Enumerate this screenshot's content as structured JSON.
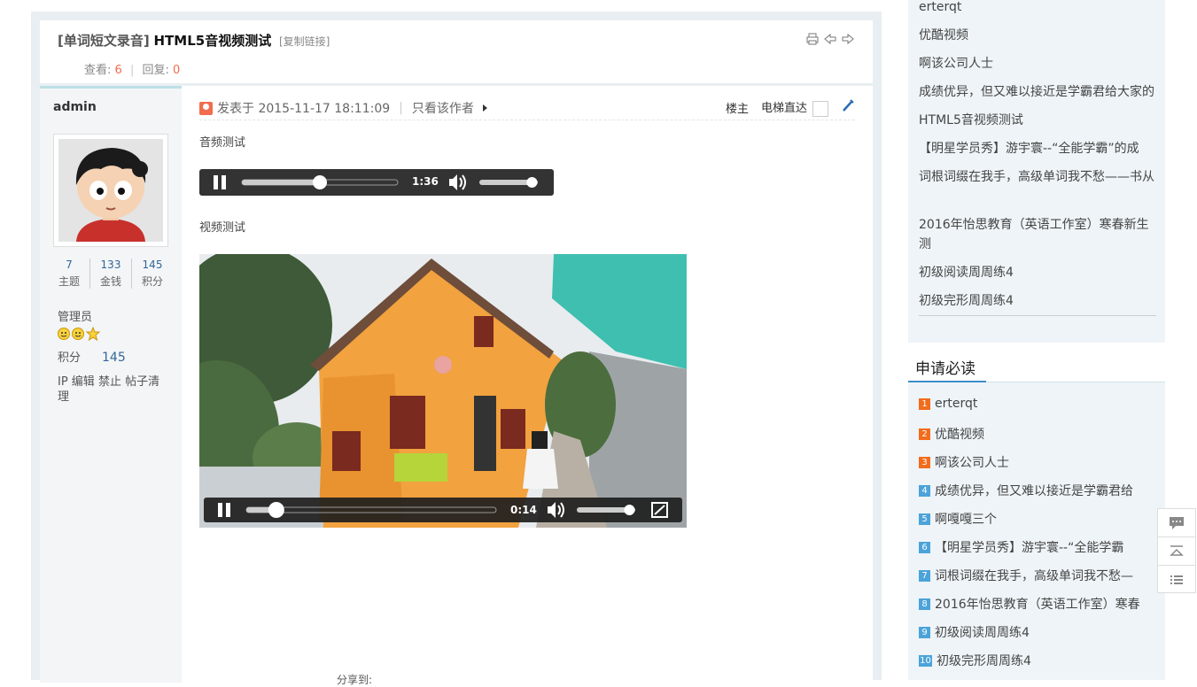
{
  "thread": {
    "category": "[单词短文录音]",
    "title": "HTML5音视频测试",
    "copy_link": "[复制链接]",
    "views_label": "查看:",
    "views": "6",
    "replies_label": "回复:",
    "replies": "0"
  },
  "author": {
    "name": "admin",
    "topics": "7",
    "topics_label": "主题",
    "money": "133",
    "money_label": "金钱",
    "points": "145",
    "points_label": "积分",
    "group": "管理员",
    "score_label": "积分",
    "score_value": "145",
    "admin_links": "IP 编辑 禁止 帖子清理"
  },
  "post": {
    "posted_label": "发表于 2015-11-17 18:11:09",
    "only_author": "只看该作者",
    "floor": "楼主",
    "elevator": "电梯直达",
    "audio_label": "音频测试",
    "audio_time": "1:36",
    "audio_progress": 0.5,
    "audio_volume": 0.9,
    "video_label": "视频测试",
    "video_time": "0:14",
    "video_progress": 0.12,
    "video_volume": 0.9,
    "share_label": "分享到:"
  },
  "sidebar_links": [
    "erterqt",
    "优酷视频",
    "啊该公司人士",
    "成绩优异，但又难以接近是学霸君给大家的",
    "HTML5音视频测试",
    "【明星学员秀】游宇寰--“全能学霸”的成",
    "词根词缀在我手，高级单词我不愁——书从",
    "2016年怡思教育（英语工作室）寒春新生测",
    "初级阅读周周练4",
    "初级完形周周练4"
  ],
  "ranking": {
    "title": "申请必读",
    "items": [
      {
        "num": "1",
        "text": "erterqt"
      },
      {
        "num": "2",
        "text": "优酷视频"
      },
      {
        "num": "3",
        "text": "啊该公司人士"
      },
      {
        "num": "4",
        "text": "成绩优异，但又难以接近是学霸君给"
      },
      {
        "num": "5",
        "text": "啊嘎嘎三个"
      },
      {
        "num": "6",
        "text": "【明星学员秀】游宇寰--“全能学霸"
      },
      {
        "num": "7",
        "text": "词根词缀在我手，高级单词我不愁—"
      },
      {
        "num": "8",
        "text": "2016年怡思教育（英语工作室）寒春"
      },
      {
        "num": "9",
        "text": "初级阅读周周练4"
      },
      {
        "num": "10",
        "text": "初级完形周周练4"
      }
    ]
  },
  "colors": {
    "accent": "#f26c4f",
    "link_blue": "#336699",
    "rank_top": "#f26c1b",
    "rank_rest": "#4ba3d9"
  }
}
